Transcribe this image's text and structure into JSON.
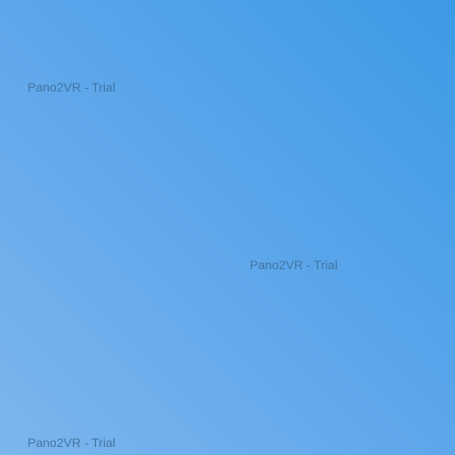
{
  "viewer": {
    "background_colors": [
      "#3d9ae6",
      "#5aa5ea",
      "#7db6ee"
    ],
    "watermarks": [
      {
        "text": "Pano2VR - Trial"
      },
      {
        "text": "Pano2VR - Trial"
      },
      {
        "text": "Pano2VR - Trial"
      }
    ]
  }
}
